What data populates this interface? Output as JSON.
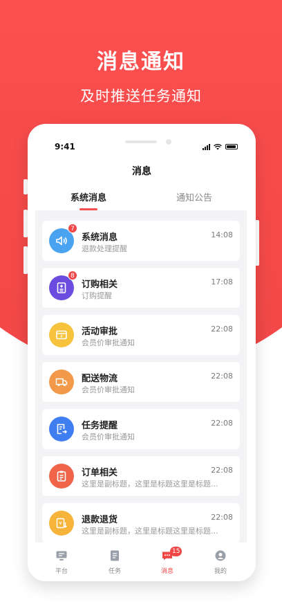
{
  "promo": {
    "headline": "消息通知",
    "subline": "及时推送任务通知"
  },
  "status_bar": {
    "time": "9:41"
  },
  "page": {
    "title": "消息"
  },
  "tabs": [
    {
      "label": "系统消息",
      "active": true
    },
    {
      "label": "通知公告",
      "active": false
    }
  ],
  "messages": [
    {
      "icon": "speaker-icon",
      "color": "#4aa3f0",
      "title": "系统消息",
      "subtitle": "退款处理提醒",
      "time": "14:08",
      "badge": "7"
    },
    {
      "icon": "order-list-icon",
      "color": "#6a4de0",
      "title": "订购相关",
      "subtitle": "订购提醒",
      "time": "17:08",
      "badge": "8"
    },
    {
      "icon": "approval-icon",
      "color": "#f7c33c",
      "title": "活动审批",
      "subtitle": "会员价审批通知",
      "time": "22:08",
      "badge": ""
    },
    {
      "icon": "truck-icon",
      "color": "#f39a4a",
      "title": "配送物流",
      "subtitle": "会员价审批通知",
      "time": "22:08",
      "badge": ""
    },
    {
      "icon": "task-icon",
      "color": "#3f7ef0",
      "title": "任务提醒",
      "subtitle": "会员价审批通知",
      "time": "22:08",
      "badge": ""
    },
    {
      "icon": "clipboard-icon",
      "color": "#f0644a",
      "title": "订单相关",
      "subtitle": "这里是副标题，这里是标题这里是标题...",
      "time": "22:08",
      "badge": ""
    },
    {
      "icon": "refund-icon",
      "color": "#f7b43a",
      "title": "退款退货",
      "subtitle": "这里是副标题，这里是标题这里是标题...",
      "time": "22:08",
      "badge": ""
    }
  ],
  "tabbar": [
    {
      "icon": "platform-icon",
      "label": "平台",
      "active": false,
      "badge": ""
    },
    {
      "icon": "task-tab-icon",
      "label": "任务",
      "active": false,
      "badge": ""
    },
    {
      "icon": "message-icon",
      "label": "消息",
      "active": true,
      "badge": "15"
    },
    {
      "icon": "profile-icon",
      "label": "我的",
      "active": false,
      "badge": ""
    }
  ],
  "colors": {
    "accent": "#f14747",
    "background_red": "#f84c4c"
  }
}
